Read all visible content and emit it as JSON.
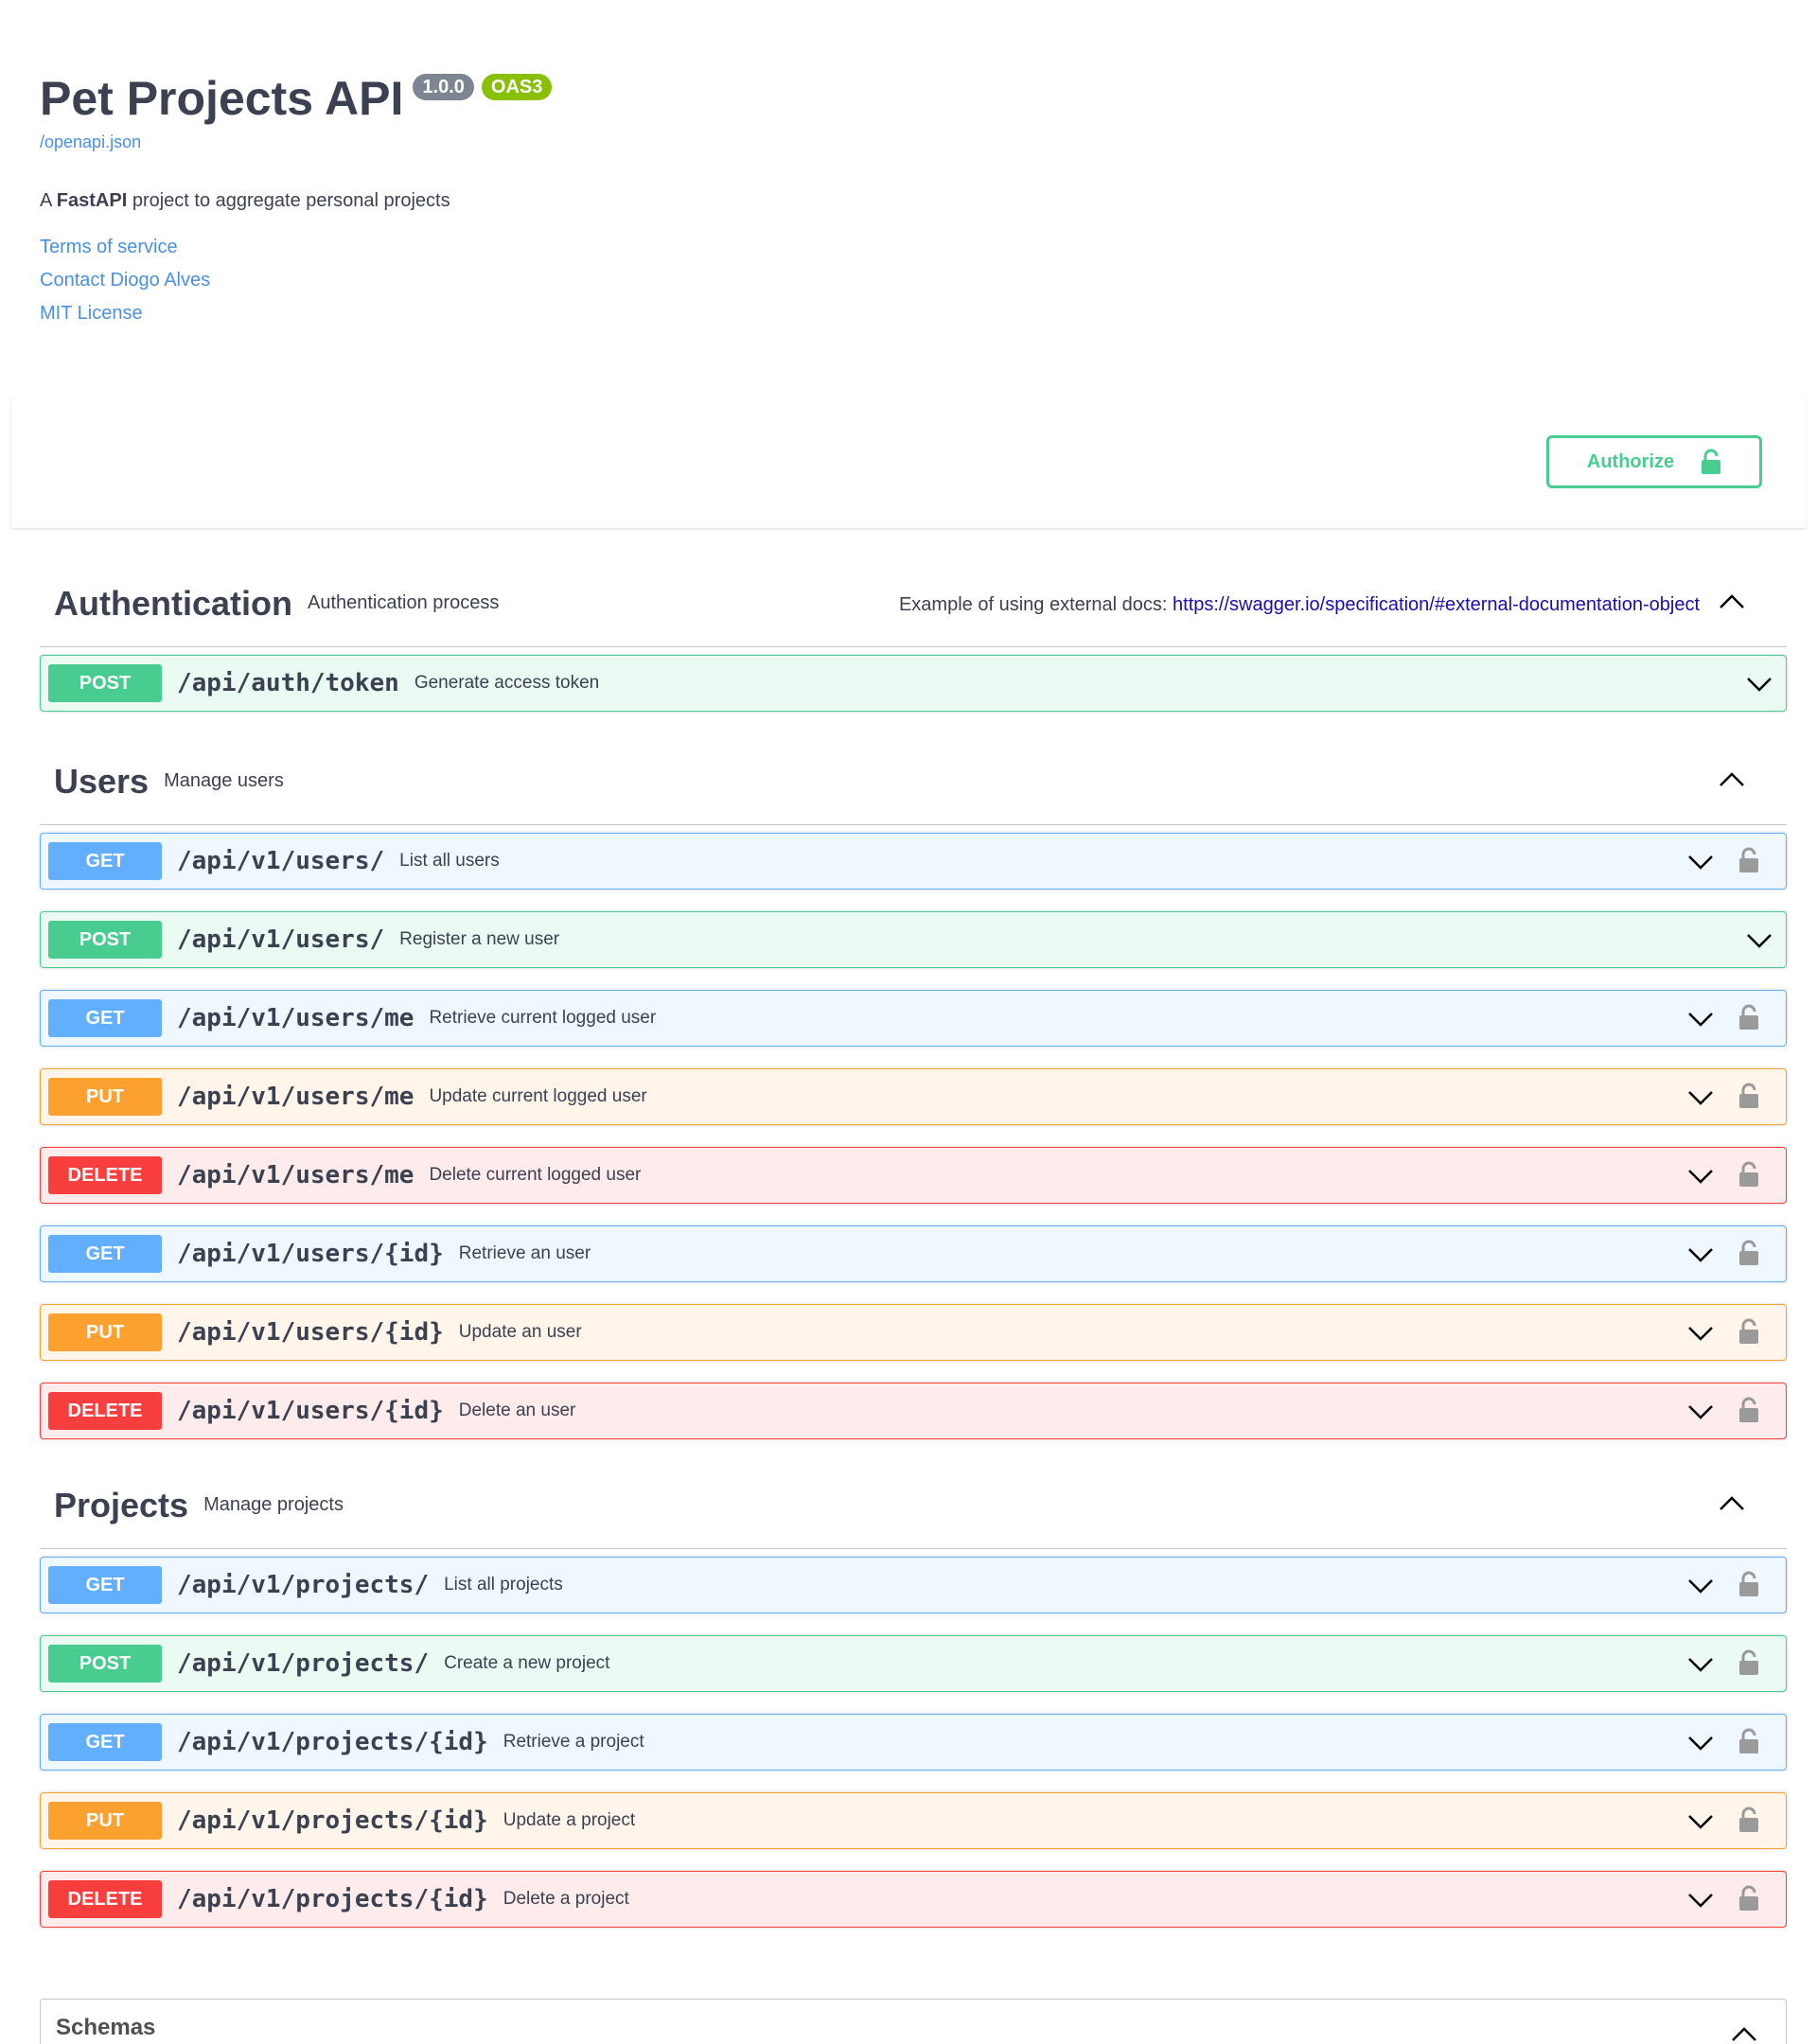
{
  "info": {
    "title": "Pet Projects API",
    "version": "1.0.0",
    "oas": "OAS3",
    "spec_link": "/openapi.json",
    "desc_prefix": "A ",
    "desc_bold": "FastAPI",
    "desc_suffix": " project to aggregate personal projects",
    "terms": "Terms of service",
    "contact": "Contact Diogo Alves",
    "license": "MIT License"
  },
  "authorize": {
    "label": "Authorize"
  },
  "sections": {
    "auth": {
      "name": "Authentication",
      "desc": "Authentication process",
      "ext_prefix": "Example of using external docs: ",
      "ext_link": "https://swagger.io/specification/#external-documentation-object",
      "ops": [
        {
          "method": "POST",
          "path": "/api/auth/token",
          "summary": "Generate access token"
        }
      ]
    },
    "users": {
      "name": "Users",
      "desc": "Manage users",
      "ops": [
        {
          "method": "GET",
          "path": "/api/v1/users/",
          "summary": "List all users"
        },
        {
          "method": "POST",
          "path": "/api/v1/users/",
          "summary": "Register a new user"
        },
        {
          "method": "GET",
          "path": "/api/v1/users/me",
          "summary": "Retrieve current logged user"
        },
        {
          "method": "PUT",
          "path": "/api/v1/users/me",
          "summary": "Update current logged user"
        },
        {
          "method": "DELETE",
          "path": "/api/v1/users/me",
          "summary": "Delete current logged user"
        },
        {
          "method": "GET",
          "path": "/api/v1/users/{id}",
          "summary": "Retrieve an user"
        },
        {
          "method": "PUT",
          "path": "/api/v1/users/{id}",
          "summary": "Update an user"
        },
        {
          "method": "DELETE",
          "path": "/api/v1/users/{id}",
          "summary": "Delete an user"
        }
      ]
    },
    "projects": {
      "name": "Projects",
      "desc": "Manage projects",
      "ops": [
        {
          "method": "GET",
          "path": "/api/v1/projects/",
          "summary": "List all projects"
        },
        {
          "method": "POST",
          "path": "/api/v1/projects/",
          "summary": "Create a new project"
        },
        {
          "method": "GET",
          "path": "/api/v1/projects/{id}",
          "summary": "Retrieve a project"
        },
        {
          "method": "PUT",
          "path": "/api/v1/projects/{id}",
          "summary": "Update a project"
        },
        {
          "method": "DELETE",
          "path": "/api/v1/projects/{id}",
          "summary": "Delete a project"
        }
      ]
    }
  },
  "schemas": {
    "title": "Schemas"
  },
  "colors": {
    "get": "#61affe",
    "post": "#49cc90",
    "put": "#fca130",
    "delete": "#f93e3e",
    "link": "#4990e2"
  }
}
